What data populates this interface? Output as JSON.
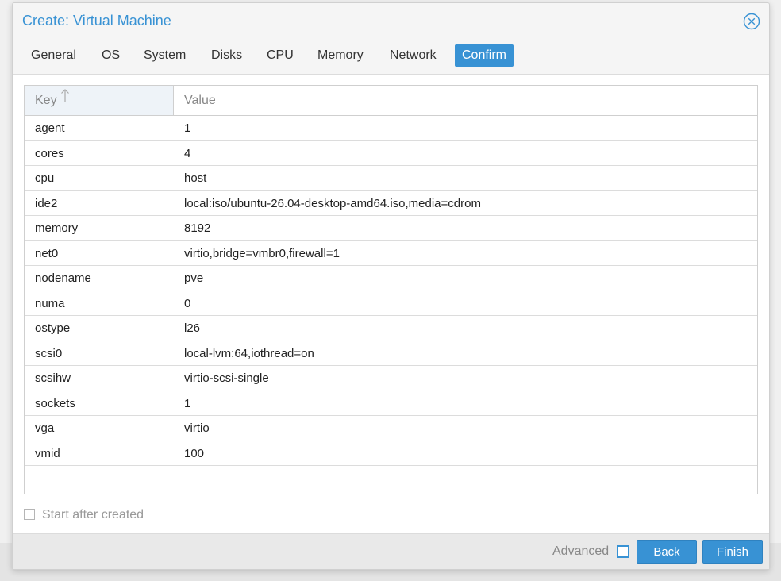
{
  "window": {
    "title": "Create: Virtual Machine"
  },
  "tabs": [
    {
      "label": "General"
    },
    {
      "label": "OS"
    },
    {
      "label": "System"
    },
    {
      "label": "Disks"
    },
    {
      "label": "CPU"
    },
    {
      "label": "Memory"
    },
    {
      "label": "Network"
    },
    {
      "label": "Confirm",
      "active": true
    }
  ],
  "grid": {
    "columns": {
      "key": "Key",
      "value": "Value"
    },
    "sort": {
      "column": "key",
      "direction": "ascending"
    },
    "rows": [
      {
        "key": "agent",
        "value": "1"
      },
      {
        "key": "cores",
        "value": "4"
      },
      {
        "key": "cpu",
        "value": "host"
      },
      {
        "key": "ide2",
        "value": "local:iso/ubuntu-26.04-desktop-amd64.iso,media=cdrom"
      },
      {
        "key": "memory",
        "value": "8192"
      },
      {
        "key": "net0",
        "value": "virtio,bridge=vmbr0,firewall=1"
      },
      {
        "key": "nodename",
        "value": "pve"
      },
      {
        "key": "numa",
        "value": "0"
      },
      {
        "key": "ostype",
        "value": "l26"
      },
      {
        "key": "scsi0",
        "value": "local-lvm:64,iothread=on"
      },
      {
        "key": "scsihw",
        "value": "virtio-scsi-single"
      },
      {
        "key": "sockets",
        "value": "1"
      },
      {
        "key": "vga",
        "value": "virtio"
      },
      {
        "key": "vmid",
        "value": "100"
      }
    ]
  },
  "options": {
    "start_after_created": {
      "label": "Start after created",
      "checked": false
    }
  },
  "footer": {
    "advanced_label": "Advanced",
    "advanced_checked": false,
    "back_label": "Back",
    "finish_label": "Finish"
  },
  "colors": {
    "accent": "#3892d4",
    "header_key_bg": "#eef3f8"
  }
}
